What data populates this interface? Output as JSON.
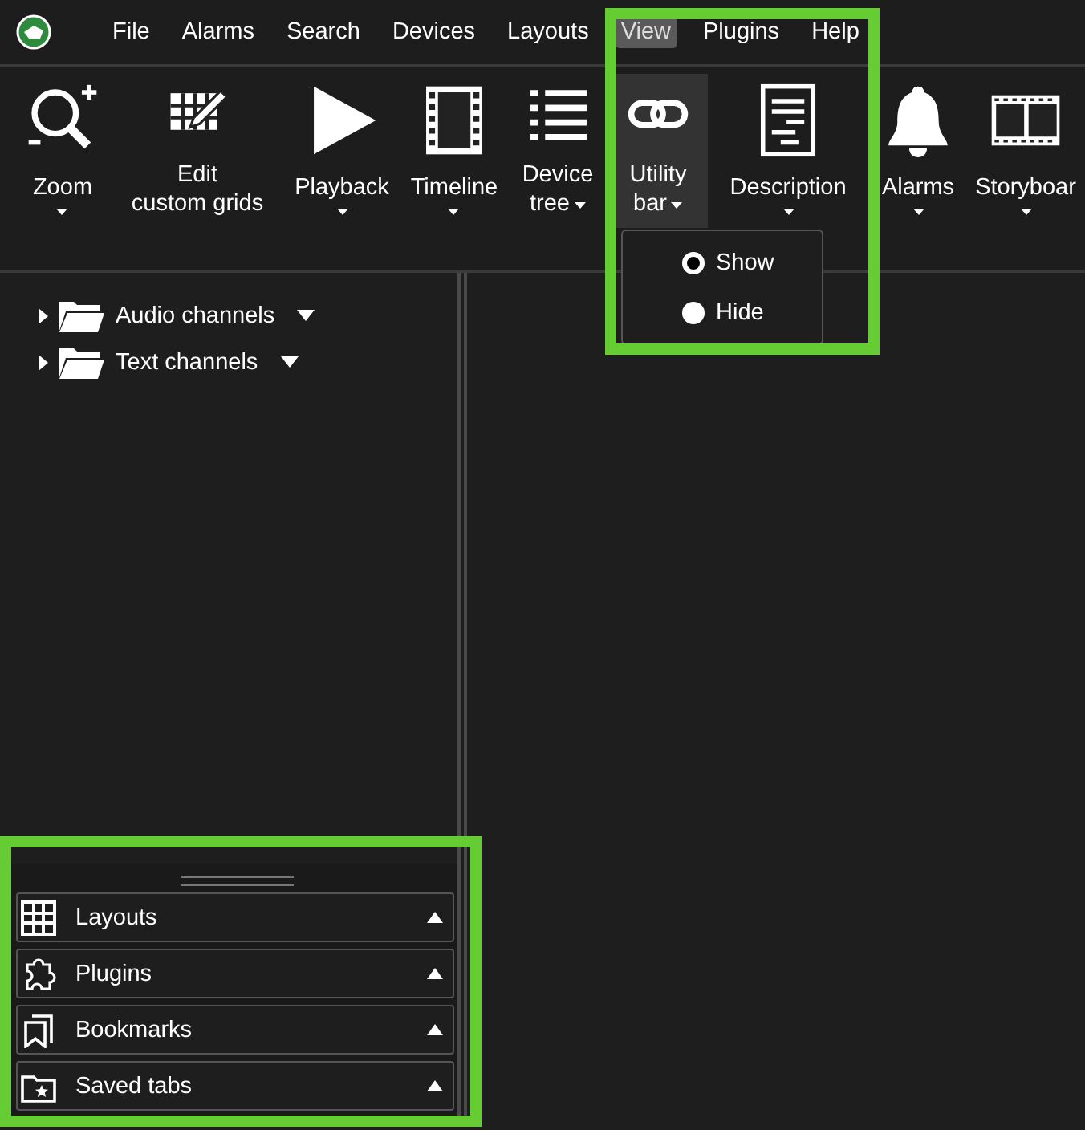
{
  "menu_bar": {
    "items": [
      {
        "label": "File",
        "selected": false
      },
      {
        "label": "Alarms",
        "selected": false
      },
      {
        "label": "Search",
        "selected": false
      },
      {
        "label": "Devices",
        "selected": false
      },
      {
        "label": "Layouts",
        "selected": false
      },
      {
        "label": "View",
        "selected": true
      },
      {
        "label": "Plugins",
        "selected": false
      },
      {
        "label": "Help",
        "selected": false
      }
    ]
  },
  "toolbar": {
    "items": [
      {
        "kind": "zoom",
        "label": "Zoom",
        "selected": false,
        "dropdown": true
      },
      {
        "kind": "grid",
        "label": "Edit\ncustom grids",
        "selected": false,
        "dropdown": false
      },
      {
        "kind": "play",
        "label": "Playback",
        "selected": false,
        "dropdown": true
      },
      {
        "kind": "film",
        "label": "Timeline",
        "selected": false,
        "dropdown": true
      },
      {
        "kind": "list",
        "label": "Device\ntree",
        "selected": false,
        "dropdown": true
      },
      {
        "kind": "link",
        "label": "Utility\nbar",
        "selected": true,
        "dropdown": true
      },
      {
        "kind": "doc",
        "label": "Description",
        "selected": false,
        "dropdown": true
      },
      {
        "kind": "bell",
        "label": "Alarms",
        "selected": false,
        "dropdown": true
      },
      {
        "kind": "strip",
        "label": "Storyboar",
        "selected": false,
        "dropdown": true
      }
    ]
  },
  "dropdown": {
    "items": [
      {
        "label": "Show",
        "selected": true
      },
      {
        "label": "Hide",
        "selected": false
      }
    ]
  },
  "tree": {
    "items": [
      {
        "label": "Audio channels"
      },
      {
        "label": "Text channels"
      }
    ]
  },
  "bottom_panels": {
    "items": [
      {
        "kind": "grid",
        "label": "Layouts"
      },
      {
        "kind": "puzzle",
        "label": "Plugins"
      },
      {
        "kind": "bookmark",
        "label": "Bookmarks"
      },
      {
        "kind": "folder-star",
        "label": "Saved tabs"
      }
    ]
  }
}
